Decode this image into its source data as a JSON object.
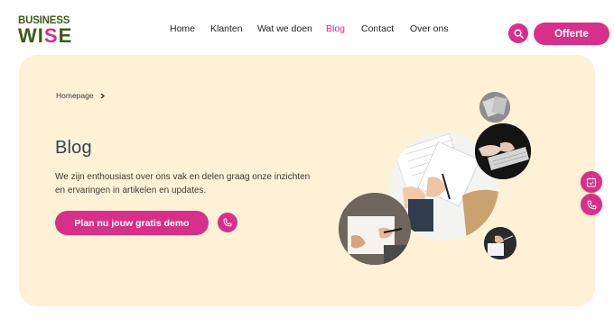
{
  "logo": {
    "line1": "BUSINESS",
    "line2_a": "WI",
    "line2_b": "S",
    "line2_c": "E"
  },
  "nav": {
    "items": [
      {
        "label": "Home"
      },
      {
        "label": "Klanten"
      },
      {
        "label": "Wat we doen"
      },
      {
        "label": "Blog"
      },
      {
        "label": "Contact"
      },
      {
        "label": "Over ons"
      }
    ],
    "active": "Blog"
  },
  "header": {
    "search_icon": "search-icon",
    "offerte_label": "Offerte"
  },
  "breadcrumb": {
    "home": "Homepage",
    "separator_icon": "chevron-right-icon"
  },
  "hero": {
    "title": "Blog",
    "intro": "We zijn enthousiast over ons vak en delen graag onze inzichten en ervaringen in artikelen en updates.",
    "demo_label": "Plan nu jouw gratis demo",
    "phone_icon": "phone-icon"
  },
  "side_buttons": {
    "calendar_icon": "calendar-check-icon",
    "phone_icon": "phone-icon"
  },
  "colors": {
    "accent": "#d6308b",
    "hero_bg": "#fff1d6",
    "logo_green": "#3e5a17",
    "title": "#2f4658"
  }
}
